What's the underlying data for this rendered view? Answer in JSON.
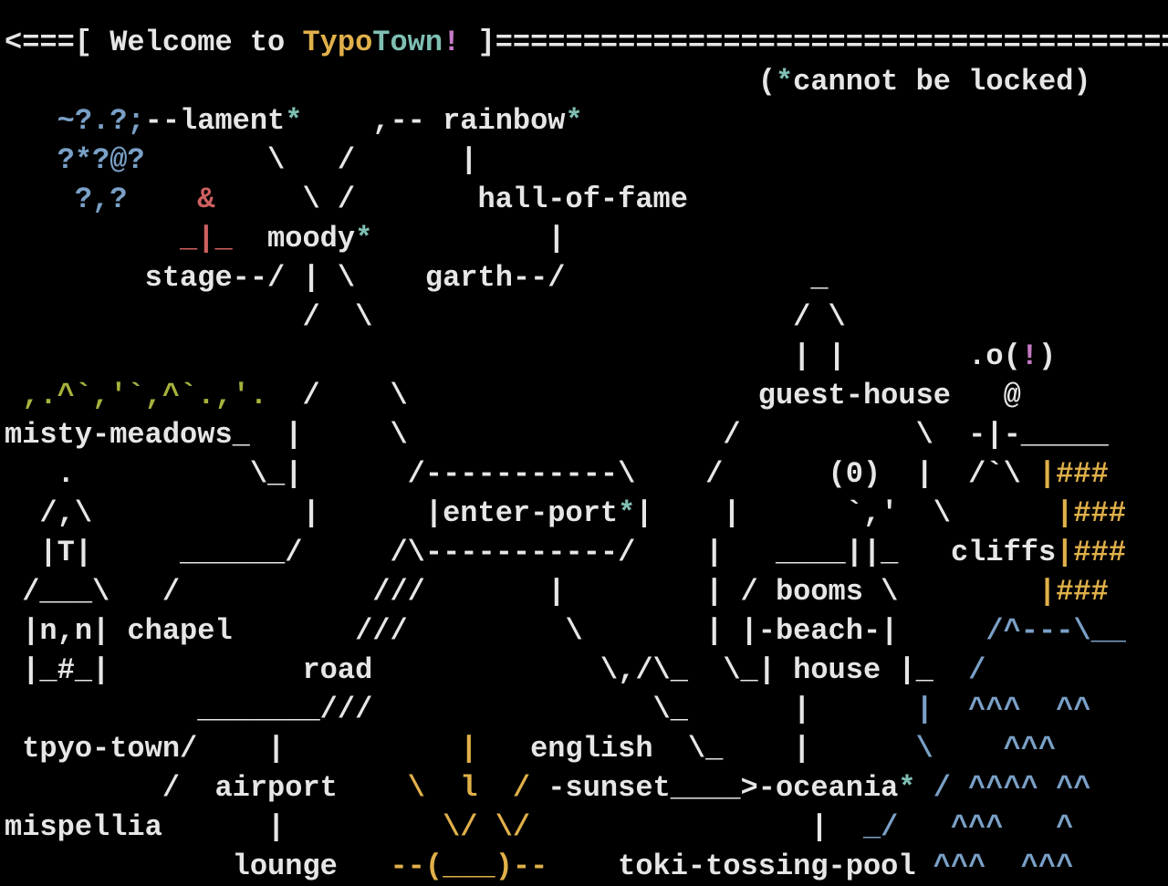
{
  "lines": [
    [
      [
        "<===[ Welcome to ",
        "wh"
      ],
      [
        "Typo",
        "yl"
      ],
      [
        "Town",
        "tl"
      ],
      [
        "!",
        "pk"
      ],
      [
        " ]=======================================>",
        "wh"
      ]
    ],
    [
      [
        "                                           (",
        "wh"
      ],
      [
        "*",
        "tl"
      ],
      [
        "cannot be locked)",
        "wh"
      ]
    ],
    [
      [
        "   ",
        "wh"
      ],
      [
        "~?.?;",
        "bl"
      ],
      [
        "--lament",
        "wh"
      ],
      [
        "*",
        "tl"
      ],
      [
        "    ,-- rainbow",
        "wh"
      ],
      [
        "*",
        "tl"
      ]
    ],
    [
      [
        "   ",
        "wh"
      ],
      [
        "?*?@?",
        "bl"
      ],
      [
        "       \\   /      |",
        "wh"
      ]
    ],
    [
      [
        "    ",
        "wh"
      ],
      [
        "?,?",
        "bl"
      ],
      [
        "    ",
        "wh"
      ],
      [
        "&",
        "rd"
      ],
      [
        "     \\ /       hall-of-fame",
        "wh"
      ]
    ],
    [
      [
        "          ",
        "wh"
      ],
      [
        "_|_",
        "rd"
      ],
      [
        "  moody",
        "wh"
      ],
      [
        "*",
        "tl"
      ],
      [
        "          |",
        "wh"
      ]
    ],
    [
      [
        "        stage--/ | \\    garth--/              _",
        "wh"
      ]
    ],
    [
      [
        "                 /  \\                        / \\",
        "wh"
      ]
    ],
    [
      [
        "                                             | |       .o(",
        "wh"
      ],
      [
        "!",
        "pk"
      ],
      [
        ")",
        "wh"
      ]
    ],
    [
      [
        " ",
        "wh"
      ],
      [
        ",.^`,'`,^`.,'.",
        "ol"
      ],
      [
        "  /    \\                    guest-house   @",
        "wh"
      ]
    ],
    [
      [
        "misty-meadows_  |     \\                  /          \\  -|-_____",
        "wh"
      ]
    ],
    [
      [
        "   .          \\_|      /-----------\\    /      (0)  |  /`\\ ",
        "wh"
      ],
      [
        "|###",
        "yl"
      ]
    ],
    [
      [
        "  /,\\            |      |enter-port",
        "wh"
      ],
      [
        "*",
        "tl"
      ],
      [
        "|    |      `,'  \\      ",
        "wh"
      ],
      [
        "|###",
        "yl"
      ]
    ],
    [
      [
        "  |T|     ______/     /\\-----------/    |   ____||_   cliffs",
        "wh"
      ],
      [
        "|###",
        "yl"
      ]
    ],
    [
      [
        " /___\\   /           ///       |        | / booms \\        ",
        "wh"
      ],
      [
        "|###",
        "yl"
      ]
    ],
    [
      [
        " |n,n| chapel       ///         \\       | |-beach-|     ",
        "wh"
      ],
      [
        "/^---\\__",
        "bl"
      ]
    ],
    [
      [
        " |_#_|           road             \\,/\\_  \\_| house |_  ",
        "wh"
      ],
      [
        "/",
        "bl"
      ]
    ],
    [
      [
        "           _______///                \\_      |      ",
        "wh"
      ],
      [
        "|  ^^^  ^^",
        "bl"
      ]
    ],
    [
      [
        " tpyo-town/    |          ",
        "wh"
      ],
      [
        "|",
        "yl"
      ],
      [
        "   english  \\_    |      ",
        "wh"
      ],
      [
        "\\    ^^^",
        "bl"
      ]
    ],
    [
      [
        "         /  airport    ",
        "wh"
      ],
      [
        "\\  l  /",
        "yl"
      ],
      [
        " -sunset____>-oceania",
        "wh"
      ],
      [
        "*",
        "tl"
      ],
      [
        " ",
        "wh"
      ],
      [
        "/ ^^^^ ^^",
        "bl"
      ]
    ],
    [
      [
        "mispellia      |         ",
        "wh"
      ],
      [
        "\\/ \\/",
        "yl"
      ],
      [
        "                |  ",
        "wh"
      ],
      [
        "_/   ^^^   ^",
        "bl"
      ]
    ],
    [
      [
        "             lounge   ",
        "wh"
      ],
      [
        "--(___)--",
        "yl"
      ],
      [
        "    toki-tossing-pool ",
        "wh"
      ],
      [
        "^^^  ^^^",
        "bl"
      ]
    ]
  ]
}
